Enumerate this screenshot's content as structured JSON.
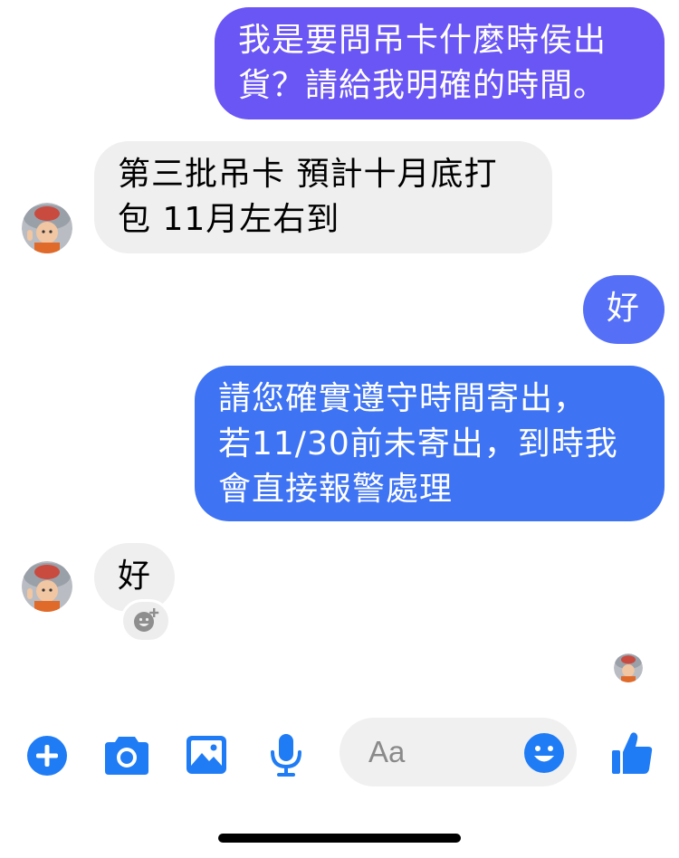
{
  "messages": [
    {
      "direction": "outgoing",
      "lines": [
        "我是要問吊卡什麼時侯出",
        "貨？請給我明確的時間。"
      ]
    },
    {
      "direction": "incoming",
      "lines": [
        "第三批吊卡 預計十月底打",
        "包 11月左右到"
      ]
    },
    {
      "direction": "outgoing",
      "lines": [
        "好"
      ]
    },
    {
      "direction": "outgoing",
      "lines": [
        "請您確實遵守時間寄出，",
        "若11/30前未寄出，到時我",
        "會直接報警處理"
      ]
    },
    {
      "direction": "incoming",
      "lines": [
        "好"
      ]
    }
  ],
  "composer": {
    "placeholder": "Aa"
  },
  "toolbar": {
    "icons": [
      "plus-icon",
      "camera-icon",
      "gallery-icon",
      "microphone-icon",
      "emoji-icon",
      "thumbs-up-icon"
    ]
  },
  "colors": {
    "bubble_outgoing_top": "#6a55f5",
    "bubble_outgoing_mid": "#556ff7",
    "bubble_outgoing_bottom": "#3e73f4",
    "bubble_incoming": "#efefef",
    "accent": "#1f7cf5"
  }
}
